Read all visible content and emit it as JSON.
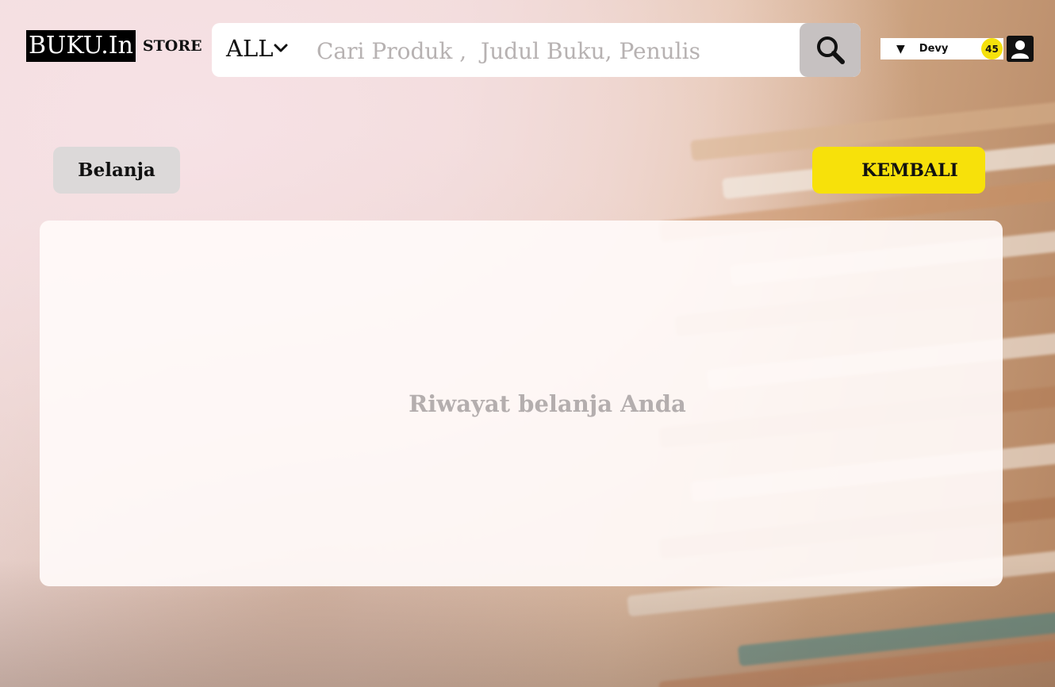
{
  "brand": {
    "logo": "BUKU.In",
    "store": "STORE"
  },
  "search": {
    "category": "ALL",
    "placeholder": "Cari Produk ,  Judul Buku, Penulis",
    "value": ""
  },
  "user": {
    "name": "Devy",
    "badge_count": "45"
  },
  "actions": {
    "belanja_label": "Belanja",
    "kembali_label": "KEMBALI"
  },
  "main": {
    "empty_text": "Riwayat belanja Anda"
  },
  "icons": {
    "category_dropdown": "chevron-down-icon",
    "search": "search-icon",
    "user_menu": "caret-down-icon",
    "avatar": "user-icon"
  },
  "colors": {
    "accent_yellow": "#f7e10a",
    "search_button": "#c6c1c1",
    "belanja_button": "#dcd9d9"
  }
}
